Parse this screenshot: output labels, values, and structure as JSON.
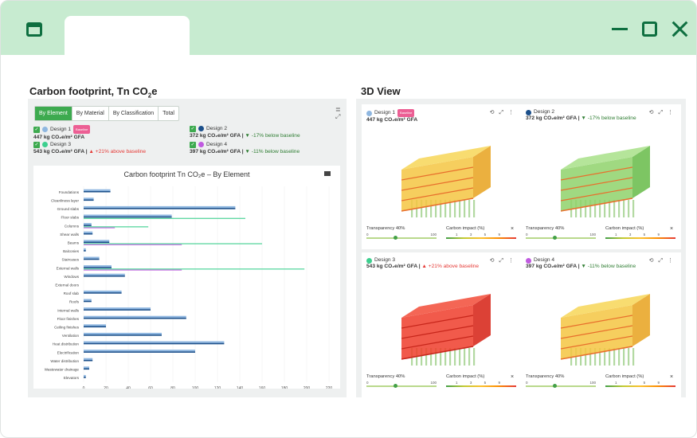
{
  "window": {
    "controls": [
      "minimize-icon",
      "maximize-icon",
      "close-icon"
    ]
  },
  "left_title": {
    "main": "Carbon footprint, Tn CO",
    "sub": "2",
    "end": "e"
  },
  "right_title": "3D View",
  "tabs": [
    "By Element",
    "By Material",
    "By Classification",
    "Total"
  ],
  "active_tab": "By Element",
  "designs": [
    {
      "name": "Design 1",
      "badge": "Baseline",
      "value": "447 kg CO₂e/m² GFA",
      "delta": "",
      "color": "#8fb7e0"
    },
    {
      "name": "Design 2",
      "badge": "",
      "value": "372 kg CO₂e/m² GFA |",
      "delta": "▼ -17% below baseline",
      "color": "#1b4f8a"
    },
    {
      "name": "Design 3",
      "badge": "",
      "value": "543 kg CO₂e/m² GFA |",
      "delta": "▲ +21% above baseline",
      "color": "#3ccf8e"
    },
    {
      "name": "Design 4",
      "badge": "",
      "value": "397 kg CO₂e/m² GFA |",
      "delta": "▼ -11% below baseline",
      "color": "#c05ae0"
    }
  ],
  "chart_data": {
    "type": "bar",
    "title": "Carbon footprint Tn CO₂e – By Element",
    "categories": [
      "Foundations",
      "Cleanliness layer",
      "Ground slabs",
      "Floor slabs",
      "Columns",
      "Shear walls",
      "Beams",
      "Balconies",
      "Staircases",
      "External walls",
      "Windows",
      "External doors",
      "Roof slab",
      "Roofs",
      "Internal walls",
      "Floor finishes",
      "Ceiling finishes",
      "Ventilation",
      "Heat distribution",
      "Electrification",
      "Water distribution",
      "Wastewater drainage",
      "Elevators"
    ],
    "series": [
      {
        "name": "Design 1",
        "color": "#8fb7e0",
        "values": [
          24,
          9,
          136,
          79,
          7,
          8,
          23,
          2,
          14,
          25,
          37,
          0,
          34,
          7,
          60,
          92,
          20,
          70,
          126,
          100,
          8,
          5,
          2
        ]
      },
      {
        "name": "Design 2",
        "color": "#1b4f8a",
        "values": [
          24,
          9,
          136,
          79,
          7,
          8,
          23,
          2,
          14,
          25,
          37,
          0,
          34,
          7,
          60,
          92,
          20,
          70,
          126,
          100,
          8,
          5,
          2
        ]
      },
      {
        "name": "Design 3",
        "color": "#3ccf8e",
        "values": [
          0,
          0,
          0,
          145,
          58,
          0,
          160,
          0,
          0,
          198,
          0,
          0,
          0,
          0,
          0,
          0,
          0,
          0,
          0,
          0,
          0,
          0,
          0
        ]
      },
      {
        "name": "Design 4",
        "color": "#c05ae0",
        "values": [
          0,
          0,
          0,
          0,
          28,
          0,
          88,
          0,
          0,
          88,
          0,
          0,
          0,
          0,
          0,
          0,
          0,
          0,
          0,
          0,
          0,
          0,
          0
        ]
      }
    ],
    "xticks": [
      "0",
      "20",
      "40",
      "60",
      "80",
      "100",
      "120",
      "140",
      "160",
      "180",
      "200",
      "220"
    ],
    "xlim": [
      0,
      220
    ]
  },
  "views": [
    {
      "name": "Design 1",
      "badge": "Baseline",
      "value": "447 kg CO₂e/m² GFA",
      "delta": "",
      "scheme": "yellow"
    },
    {
      "name": "Design 2",
      "badge": "",
      "value": "372 kg CO₂e/m² GFA |",
      "delta": "▼ -17% below baseline",
      "scheme": "green"
    },
    {
      "name": "Design 3",
      "badge": "",
      "value": "543 kg CO₂e/m² GFA |",
      "delta": "▲ +21% above baseline",
      "scheme": "red"
    },
    {
      "name": "Design 4",
      "badge": "",
      "value": "397 kg CO₂e/m² GFA |",
      "delta": "▼ -11% below baseline",
      "scheme": "yellow"
    }
  ],
  "view_controls": {
    "transparency_label": "Transparency 40%",
    "transparency_min": "0",
    "transparency_max": "100",
    "transparency_value": 0.4,
    "impact_label": "Carbon impact (%)",
    "impact_ticks": [
      "1",
      "3",
      "5",
      "9"
    ],
    "tools": "⟲ ⤢ ⋮",
    "close": "×"
  }
}
